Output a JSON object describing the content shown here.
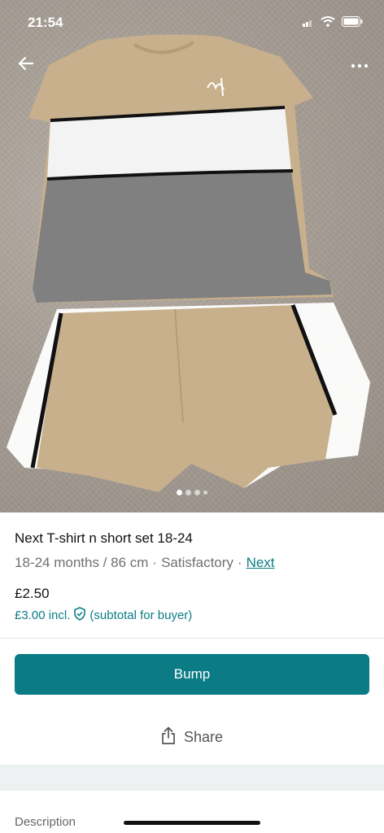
{
  "status_bar": {
    "time": "21:54",
    "icons": [
      "signal-icon",
      "wifi-icon",
      "battery-icon"
    ]
  },
  "hero": {
    "image_subject": "beige, white and grey striped t-shirt with matching shorts on carpet",
    "carousel": {
      "total": 4,
      "active_index": 0
    }
  },
  "nav": {
    "back_icon": "back-arrow-icon",
    "more_icon": "more-options-icon"
  },
  "item": {
    "title": "Next T-shirt n short set 18-24",
    "size": "18-24 months / 86 cm",
    "sep1": "·",
    "condition": "Satisfactory",
    "sep2": "·",
    "brand": "Next",
    "price": "£2.50",
    "price_incl": "£3.00 incl.",
    "price_note": "(subtotal for buyer)"
  },
  "actions": {
    "bump_label": "Bump",
    "share_label": "Share"
  },
  "description": {
    "heading": "Description"
  },
  "colors": {
    "accent": "#0b7c85"
  }
}
